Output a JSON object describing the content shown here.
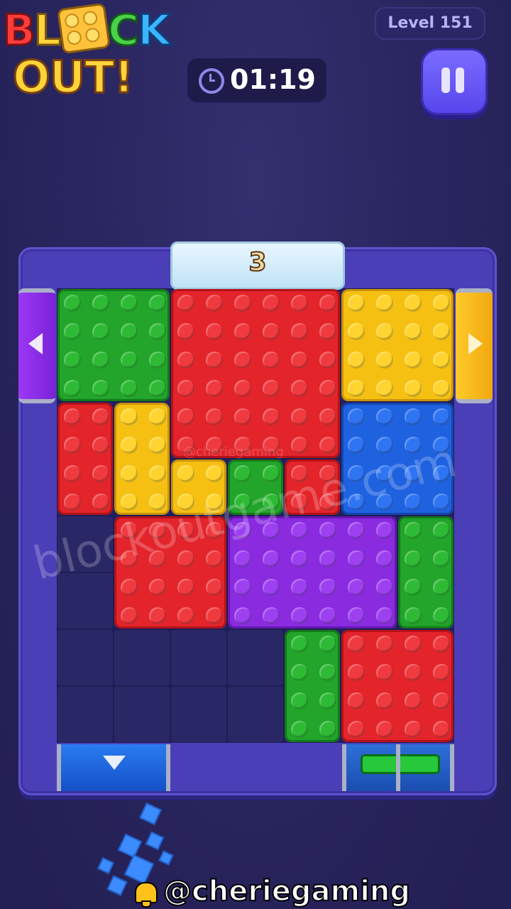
{
  "game": {
    "logo_text_line1": "BLOCK",
    "logo_text_line2": "OUT!",
    "level_label": "Level 151",
    "timer": "01:19",
    "top_exit_counter": "3"
  },
  "watermarks": {
    "site": "blockoutgame.com",
    "handle_small": "@cheriegaming"
  },
  "footer": {
    "handle": "@cheriegaming"
  },
  "colors": {
    "red": "#e3242b",
    "green": "#22a52a",
    "yellow": "#f5c012",
    "blue": "#1f62e0",
    "purple": "#8a2be0",
    "board": "#4b3fb8",
    "background": "#2a2660"
  },
  "icons": {
    "timer": "clock-icon",
    "pause": "pause-icon",
    "left_exit": "triangle-left-icon",
    "right_exit": "triangle-right-icon",
    "bottom_exit": "triangle-down-icon",
    "footer": "bell-icon"
  },
  "blocks": [
    {
      "id": "b1",
      "color": "green",
      "col": 0,
      "row": 0,
      "w": 2,
      "h": 2
    },
    {
      "id": "b2",
      "color": "red",
      "col": 2,
      "row": 0,
      "w": 3,
      "h": 3
    },
    {
      "id": "b3",
      "color": "yellow",
      "col": 5,
      "row": 0,
      "w": 2,
      "h": 2
    },
    {
      "id": "b4",
      "color": "red",
      "col": 0,
      "row": 2,
      "w": 1,
      "h": 2
    },
    {
      "id": "b5",
      "color": "yellow",
      "col": 1,
      "row": 2,
      "w": 1,
      "h": 2
    },
    {
      "id": "b6",
      "color": "blue",
      "col": 5,
      "row": 2,
      "w": 2,
      "h": 2
    },
    {
      "id": "b7",
      "color": "yellow",
      "col": 2,
      "row": 3,
      "w": 1,
      "h": 1
    },
    {
      "id": "b8",
      "color": "green",
      "col": 3,
      "row": 3,
      "w": 1,
      "h": 1
    },
    {
      "id": "b9",
      "color": "red",
      "col": 4,
      "row": 3,
      "w": 1,
      "h": 1
    },
    {
      "id": "b10",
      "color": "red",
      "col": 1,
      "row": 4,
      "w": 2,
      "h": 2
    },
    {
      "id": "b11",
      "color": "purple",
      "col": 3,
      "row": 4,
      "w": 3,
      "h": 2
    },
    {
      "id": "b12",
      "color": "green",
      "col": 6,
      "row": 4,
      "w": 1,
      "h": 2
    },
    {
      "id": "b13",
      "color": "green",
      "col": 4,
      "row": 6,
      "w": 1,
      "h": 2
    },
    {
      "id": "b14",
      "color": "red",
      "col": 5,
      "row": 6,
      "w": 2,
      "h": 2
    }
  ]
}
